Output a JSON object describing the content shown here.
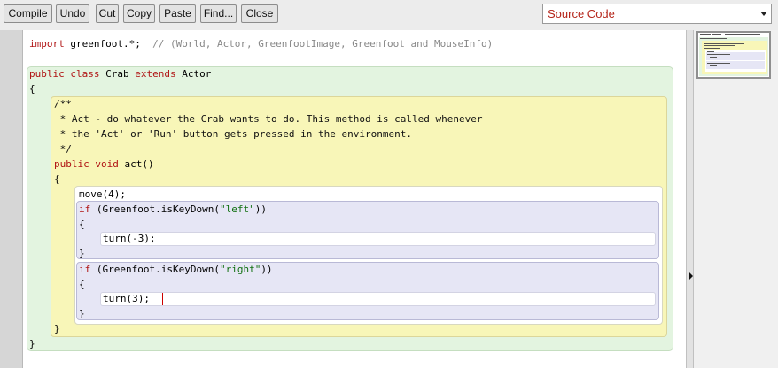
{
  "toolbar": {
    "buttons": [
      "Compile",
      "Undo",
      "Cut",
      "Copy",
      "Paste",
      "Find...",
      "Close"
    ],
    "view_mode": "Source Code"
  },
  "code": {
    "lines": {
      "import_kw": "import",
      "import_rest": " greenfoot.*;  ",
      "import_comment": "// (World, Actor, GreenfootImage, Greenfoot and MouseInfo)",
      "class_kw1": "public",
      "class_kw2": "class",
      "class_name": "Crab",
      "class_kw3": "extends",
      "class_super": "Actor",
      "brace_open_class": "{",
      "jd1": "/**",
      "jd2": " * Act - do whatever the Crab wants to do. This method is called whenever",
      "jd3": " * the 'Act' or 'Run' button gets pressed in the environment.",
      "jd4": " */",
      "m_kw1": "public",
      "m_kw2": "void",
      "m_sig": "act()",
      "brace_open_method": "{",
      "move": "move(4);",
      "if1_kw": "if",
      "if1_a": " (Greenfoot.isKeyDown(",
      "if1_str": "\"left\"",
      "if1_b": "))",
      "if1_open": "{",
      "turn1": "turn(-3);",
      "if1_close": "}",
      "if2_kw": "if",
      "if2_a": " (Greenfoot.isKeyDown(",
      "if2_str": "\"right\"",
      "if2_b": "))",
      "if2_open": "{",
      "turn2": "turn(3);",
      "if2_close": "}",
      "brace_close_method": "}",
      "brace_close_class": "}"
    }
  },
  "colors": {
    "keyword": "#b01414",
    "string": "#117011",
    "comment": "#888888",
    "class_scope": "#e3f4e0",
    "method_scope": "#f8f6b8",
    "if_scope": "#e6e6f5"
  }
}
